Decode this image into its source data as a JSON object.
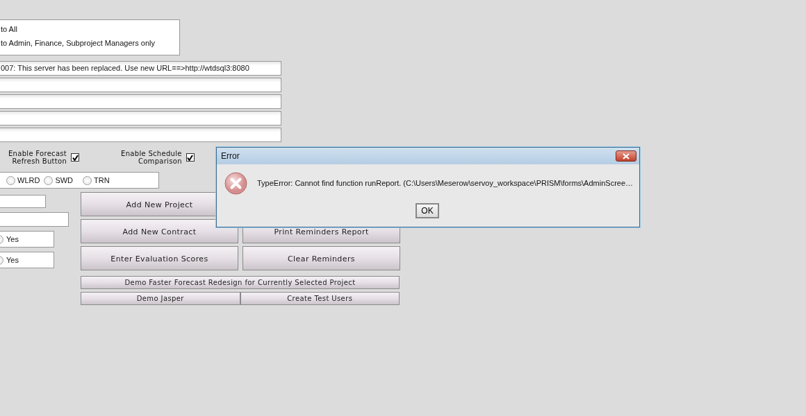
{
  "permission_options": [
    "to All",
    "to Admin, Finance, Subproject Managers only"
  ],
  "text_fields": [
    {
      "kind": "filled",
      "value": "007: This server has been replaced. Use new URL==>http://wtdsql3:8080"
    },
    {
      "kind": "empty"
    },
    {
      "kind": "empty"
    },
    {
      "kind": "empty"
    },
    {
      "kind": "empty"
    }
  ],
  "checkboxes": [
    {
      "lines": [
        "Enable Forecast",
        "Refresh Button"
      ],
      "checked": true
    },
    {
      "lines": [
        "Enable Schedule",
        "Comparison"
      ],
      "checked": true
    }
  ],
  "region_radios": [
    {
      "label": "WLRD",
      "selected": false
    },
    {
      "label": "SWD",
      "selected": false
    },
    {
      "label": "TRN",
      "selected": false
    }
  ],
  "left_controls": [
    {
      "kind": "field"
    },
    {
      "kind": "field"
    },
    {
      "kind": "radio",
      "label": "Yes",
      "selected": false
    },
    {
      "kind": "radio",
      "label": "Yes",
      "selected": false
    }
  ],
  "button_rows": [
    {
      "buttons": [
        "Add New Project"
      ]
    },
    {
      "buttons": [
        "Add New Contract",
        "Print Reminders Report"
      ]
    },
    {
      "buttons": [
        "Enter Evaluation Scores",
        "Clear Reminders"
      ]
    }
  ],
  "small_button_rows": [
    {
      "buttons": [
        "Demo Faster Forecast Redesign for Currently Selected Project"
      ]
    },
    {
      "buttons": [
        "Demo Jasper",
        "Create Test Users"
      ]
    }
  ],
  "dialog": {
    "title": "Error",
    "message": "TypeError: Cannot find function runReport. (C:\\Users\\Meserow\\servoy_workspace\\PRISM\\forms\\AdminScree…",
    "button": "OK"
  }
}
